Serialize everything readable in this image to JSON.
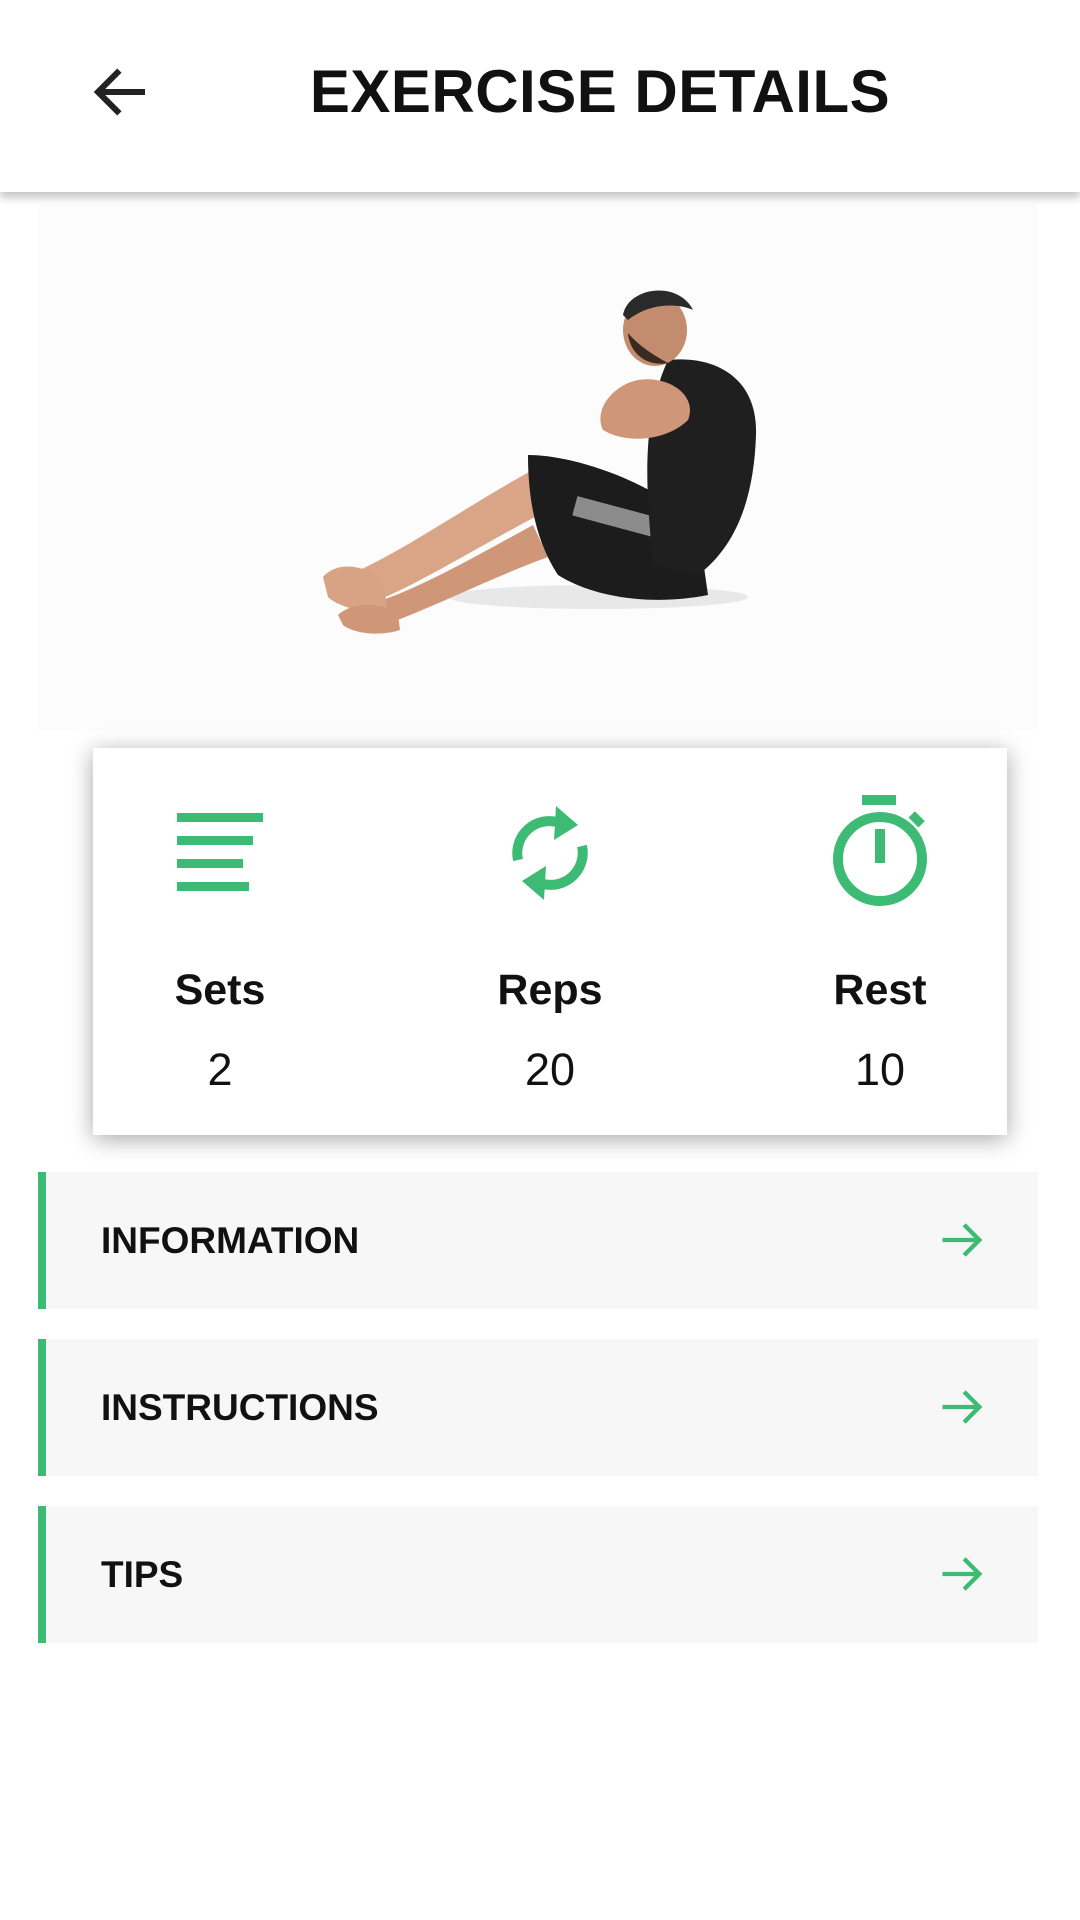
{
  "header": {
    "title": "EXERCISE DETAILS",
    "back_icon": "arrow-left-icon"
  },
  "hero": {
    "image": "person-seated-russian-twist-illustration"
  },
  "colors": {
    "accent": "#3dbb74",
    "text": "#111111",
    "row_bg": "#f7f7f7"
  },
  "stats": [
    {
      "label": "Sets",
      "value": "2",
      "icon": "list-lines-icon"
    },
    {
      "label": "Reps",
      "value": "20",
      "icon": "repeat-cycle-icon"
    },
    {
      "label": "Rest",
      "value": "10",
      "icon": "stopwatch-icon"
    }
  ],
  "sections": [
    {
      "label": "INFORMATION",
      "icon": "arrow-right-icon"
    },
    {
      "label": "INSTRUCTIONS",
      "icon": "arrow-right-icon"
    },
    {
      "label": "TIPS",
      "icon": "arrow-right-icon"
    }
  ]
}
